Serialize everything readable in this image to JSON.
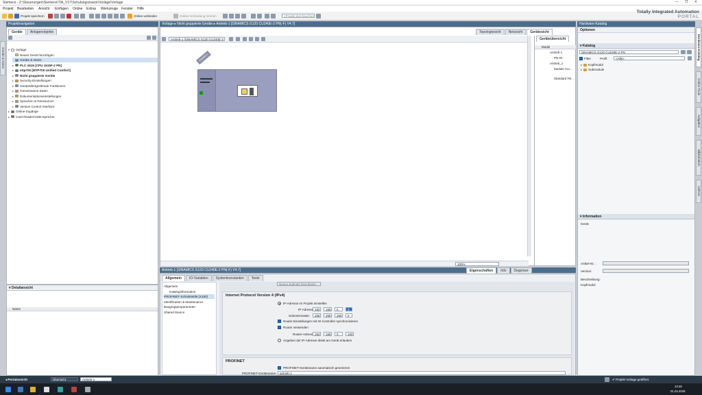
{
  "window": {
    "title": "Siemens  -  Z:\\Steuerungen\\Siemens\\TIA_V17\\Schulungszweck\\Vorlage\\Vorlage",
    "controls": [
      "—",
      "❐",
      "✕"
    ]
  },
  "menu": [
    "Projekt",
    "Bearbeiten",
    "Ansicht",
    "Einfügen",
    "Online",
    "Extras",
    "Werkzeuge",
    "Fenster",
    "Hilfe"
  ],
  "toolbar": {
    "save_label": "Projekt speichern",
    "go_online": "Online verbinden",
    "go_offline": "Online-Verbindung trennen",
    "search_placeholder": "<Projekt durchsuchen>"
  },
  "brand": {
    "line1": "Totally Integrated Automation",
    "line2": "PORTAL"
  },
  "project_nav": {
    "header": "Projektnavigation",
    "tabs": [
      "Geräte",
      "Anlagenobjekte"
    ],
    "tree": [
      {
        "label": "Vorlage",
        "level": 0,
        "color": "#ffffff"
      },
      {
        "label": "Neues Gerät hinzufügen",
        "level": 1,
        "color": "#f0c040"
      },
      {
        "label": "Geräte & Netze",
        "level": 1,
        "color": "#5a8fc8",
        "selected": true
      },
      {
        "label": "PLC-1515 [CPU 1515F-2 PN]",
        "level": 1,
        "color": "#3a7a3a",
        "bold": true
      },
      {
        "label": "mtp700 [MTP700 Unified Comfort]",
        "level": 1,
        "color": "#4a6fa0",
        "bold": true
      },
      {
        "label": "Nicht gruppierte Geräte",
        "level": 1,
        "color": "#7a8a9a",
        "bold": true
      },
      {
        "label": "Security-Einstellungen",
        "level": 1,
        "color": "#d0a030"
      },
      {
        "label": "Geräteübergreifende Funktionen",
        "level": 1,
        "color": "#6a8fb8"
      },
      {
        "label": "Gemeinsame Daten",
        "level": 1,
        "color": "#c0a060"
      },
      {
        "label": "Dokumentationseinstellungen",
        "level": 1,
        "color": "#c0a060"
      },
      {
        "label": "Sprachen & Ressourcen",
        "level": 1,
        "color": "#c0a060"
      },
      {
        "label": "Version Control Interface",
        "level": 1,
        "color": "#5a7fa8"
      },
      {
        "label": "Online-Zugänge",
        "level": 0,
        "color": "#4a8a4a"
      },
      {
        "label": "Card Reader/USB-Speicher",
        "level": 0,
        "color": "#6a6a6a"
      }
    ],
    "detail_header": "Detailansicht",
    "detail_col": "Name"
  },
  "left_sidetab": "Geräte & Netze",
  "editor": {
    "breadcrumb": "Vorlage  ▸  Nicht gruppierte Geräte  ▸  Antrieb-1 [SINAMICS G120 CU240E-2 PN(-F) V4.7]",
    "view_tabs": [
      "Topologiesicht",
      "Netzsicht",
      "Gerätesicht"
    ],
    "device_select": "Antrieb-1 [SINAMICS G120 CU240E-2 PN]",
    "rack_label": "Antrieb-1",
    "zoom": "100%",
    "overview": {
      "tab": "Geräteübersicht",
      "col": "Modul",
      "rows": [
        "Antrieb-1",
        "PN-IO",
        "Antrieb_1",
        "Module Acc...",
        "Standard Tel..."
      ]
    }
  },
  "properties": {
    "title": "Antrieb-1 [SINAMICS G120 CU240E-2 PN(-F) V4.7]",
    "right_tabs": [
      "Eigenschaften",
      "Info",
      "Diagnose"
    ],
    "tabs": [
      "Allgemein",
      "IO-Variablen",
      "Systemkonstanten",
      "Texte"
    ],
    "nav": [
      {
        "label": "Allgemein",
        "level": 0
      },
      {
        "label": "Kataloginformation",
        "level": 1
      },
      {
        "label": "PROFINET-Schnittstelle [X150]",
        "level": 0,
        "selected": true
      },
      {
        "label": "Identification & Maintenance",
        "level": 0
      },
      {
        "label": "Baugruppenparameter",
        "level": 0
      },
      {
        "label": "Shared Device",
        "level": 0
      }
    ],
    "add_subnet": "Neues Subnetz hinzufügen",
    "ipv4_header": "Internet Protocol Version 4 (IPv4)",
    "opt_set_in_project": "IP-Adresse im Projekt einstellen",
    "ip_label": "IP-Adresse:",
    "ip": [
      "192",
      "168",
      "0",
      "3"
    ],
    "mask_label": "Subnetzmaske:",
    "mask": [
      "255",
      "255",
      "255",
      "0"
    ],
    "sync_router": "Router-Einstellungen mit IO-Controller synchronisieren",
    "use_router": "Router verwenden",
    "router_label": "Router-Adresse:",
    "router": [
      "192",
      "168",
      "0",
      "100"
    ],
    "opt_set_on_device": "Angeben der IP-Adresse direkt am Gerät erlauben",
    "profinet_header": "PROFINET",
    "auto_name": "PROFINET-Gerätename automatisch generieren",
    "devname_label": "PROFINET-Gerätename:",
    "devname": "antrieb-1"
  },
  "catalog": {
    "header": "Hardware-Katalog",
    "options": "Optionen",
    "section": "Katalog",
    "search": "SINAMICS G120 CU240E-2 PN",
    "filter": "Filter",
    "profil_label": "Profil:",
    "profil": "<Alle>",
    "items": [
      "Kopfmodul",
      "Submodule"
    ],
    "info_section": "Information",
    "device_label": "Gerät:",
    "artnr_label": "Artikel-Nr.:",
    "version_label": "Version:",
    "desc_label": "Beschreibung:",
    "desc": "Kopfmodul"
  },
  "right_sidetabs": [
    "Hardware-Katalog",
    "Online-Tools",
    "Aufgaben",
    "Bibliotheken",
    "Add-ins"
  ],
  "statusbar": {
    "portal": "Portalansicht",
    "overview": "Übersicht",
    "active": "Antrieb-1",
    "message": "Projekt Vorlage geöffnet."
  },
  "taskbar": {
    "time": "13:45",
    "date": "01.04.2025"
  },
  "colors": {
    "panel_header": "#4e6d8c",
    "accent": "#1a6fc4",
    "device_body": "#9a9ebf"
  }
}
